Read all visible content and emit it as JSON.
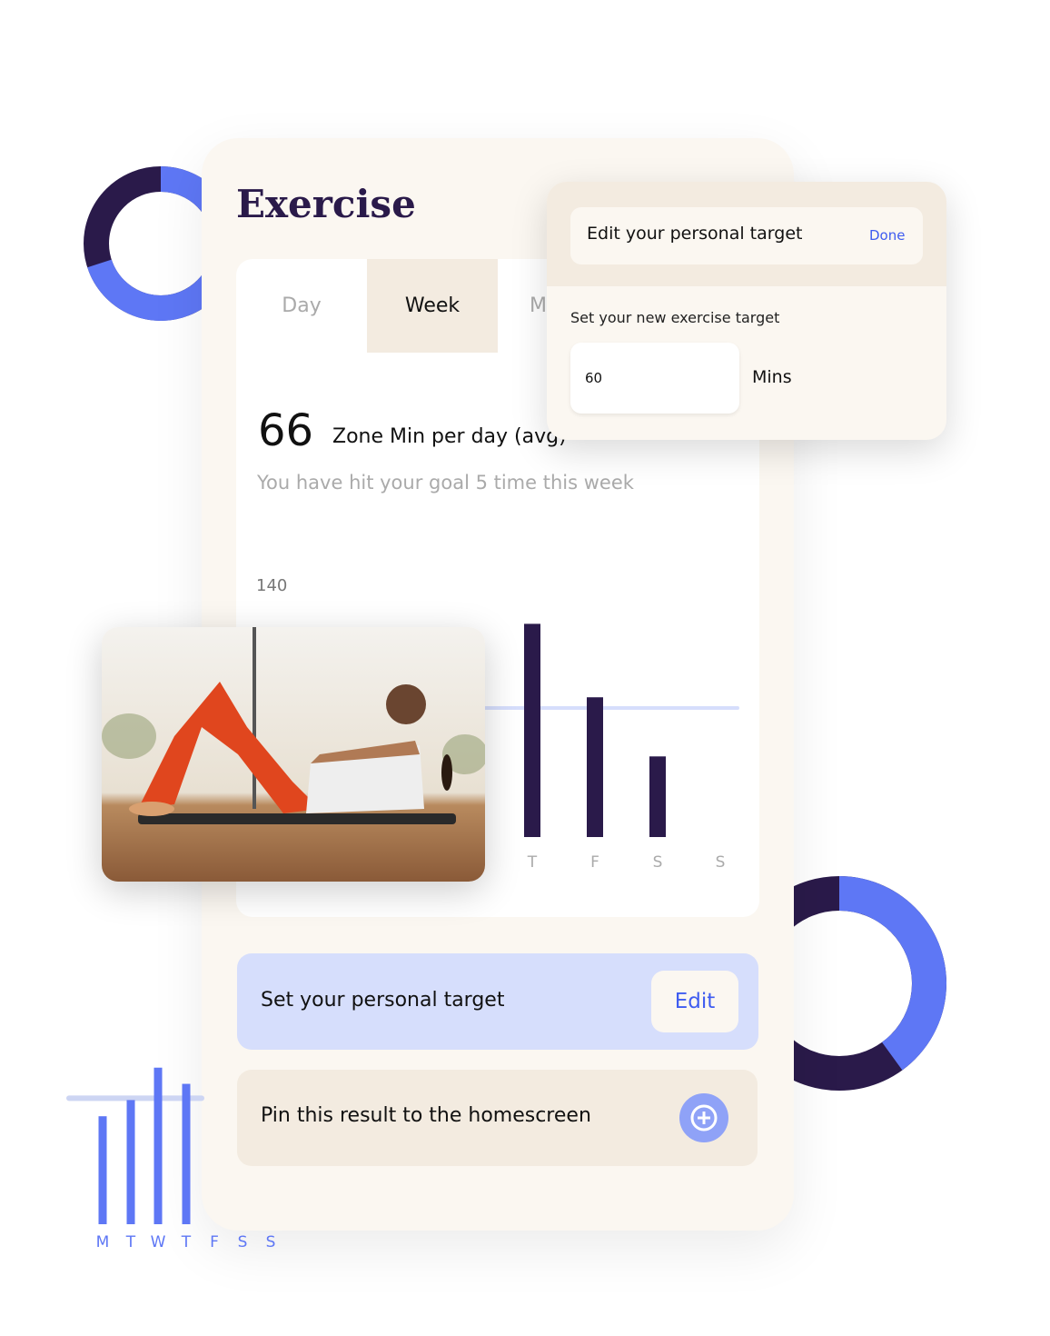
{
  "colors": {
    "accent": "#5e77f5",
    "dark": "#2a1a4a",
    "card": "#fbf7f1",
    "target_bg": "#d6defc",
    "beige": "#f3ebe0"
  },
  "header": {
    "title": "Exercise"
  },
  "tabs": [
    {
      "label": "Day",
      "active": false
    },
    {
      "label": "Week",
      "active": true
    },
    {
      "label": "M",
      "active": false
    }
  ],
  "summary": {
    "value": "66",
    "unit": "Zone Min per day (avg)",
    "subtitle": "You have hit your goal 5 time this week"
  },
  "chart_data": [
    {
      "type": "bar",
      "categories": [
        "T",
        "F",
        "S",
        "S"
      ],
      "values": [
        119,
        78,
        45,
        0
      ],
      "ylabel_top": "140",
      "ylim": [
        0,
        140
      ],
      "goal_line": 72
    },
    {
      "type": "bar",
      "categories": [
        "M",
        "T",
        "W",
        "T",
        "F",
        "S",
        "S"
      ],
      "values": [
        60,
        69,
        87,
        78,
        null,
        null,
        null
      ],
      "goal_line": 70
    }
  ],
  "donuts": [
    {
      "fraction_accent": 0.7
    },
    {
      "fraction_accent": 0.4
    }
  ],
  "target": {
    "label": "Set your personal target",
    "edit_label": "Edit"
  },
  "pin": {
    "label": "Pin this result to the homescreen",
    "icon": "plus-circle-icon"
  },
  "popup": {
    "title": "Edit your personal target",
    "done_label": "Done",
    "field_label": "Set your new exercise target",
    "value": "60",
    "unit": "Mins"
  }
}
